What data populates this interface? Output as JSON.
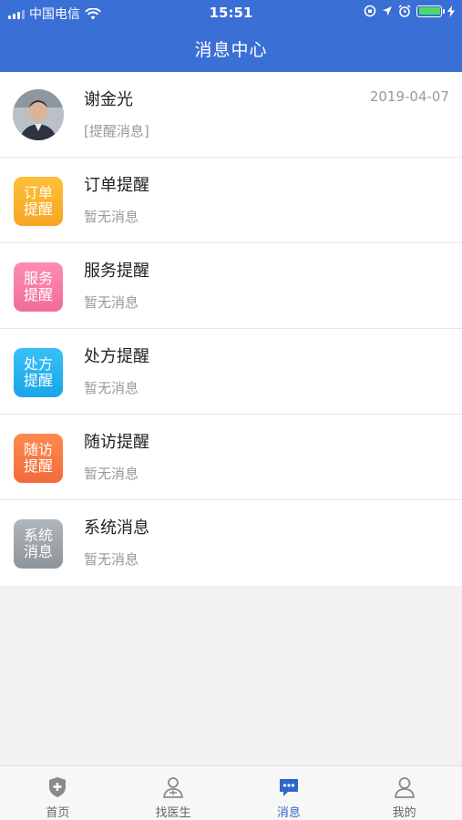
{
  "status_bar": {
    "carrier": "中国电信",
    "time": "15:51",
    "battery_color": "#4cd964"
  },
  "header": {
    "title": "消息中心",
    "color": "#3a6fd6"
  },
  "messages": [
    {
      "title": "谢金光",
      "subtitle": "[提醒消息]",
      "date": "2019-04-07",
      "icon": "avatar-photo"
    },
    {
      "title": "订单提醒",
      "subtitle": "暂无消息",
      "icon_text": [
        "订单",
        "提醒"
      ],
      "icon": "order-reminder-icon",
      "color": "#f5a623"
    },
    {
      "title": "服务提醒",
      "subtitle": "暂无消息",
      "icon_text": [
        "服务",
        "提醒"
      ],
      "icon": "service-reminder-icon",
      "color": "#f06c9b"
    },
    {
      "title": "处方提醒",
      "subtitle": "暂无消息",
      "icon_text": [
        "处方",
        "提醒"
      ],
      "icon": "prescription-reminder-icon",
      "color": "#1aa5ea"
    },
    {
      "title": "随访提醒",
      "subtitle": "暂无消息",
      "icon_text": [
        "随访",
        "提醒"
      ],
      "icon": "followup-reminder-icon",
      "color": "#f26b38"
    },
    {
      "title": "系统消息",
      "subtitle": "暂无消息",
      "icon_text": [
        "系统",
        "消息"
      ],
      "icon": "system-message-icon",
      "color": "#9a9fa3"
    }
  ],
  "tabbar": {
    "active_color": "#2f66cc",
    "items": [
      {
        "label": "首页",
        "icon": "home-shield-icon",
        "active": false
      },
      {
        "label": "找医生",
        "icon": "doctor-icon",
        "active": false
      },
      {
        "label": "消息",
        "icon": "message-icon",
        "active": true
      },
      {
        "label": "我的",
        "icon": "profile-icon",
        "active": false
      }
    ]
  }
}
